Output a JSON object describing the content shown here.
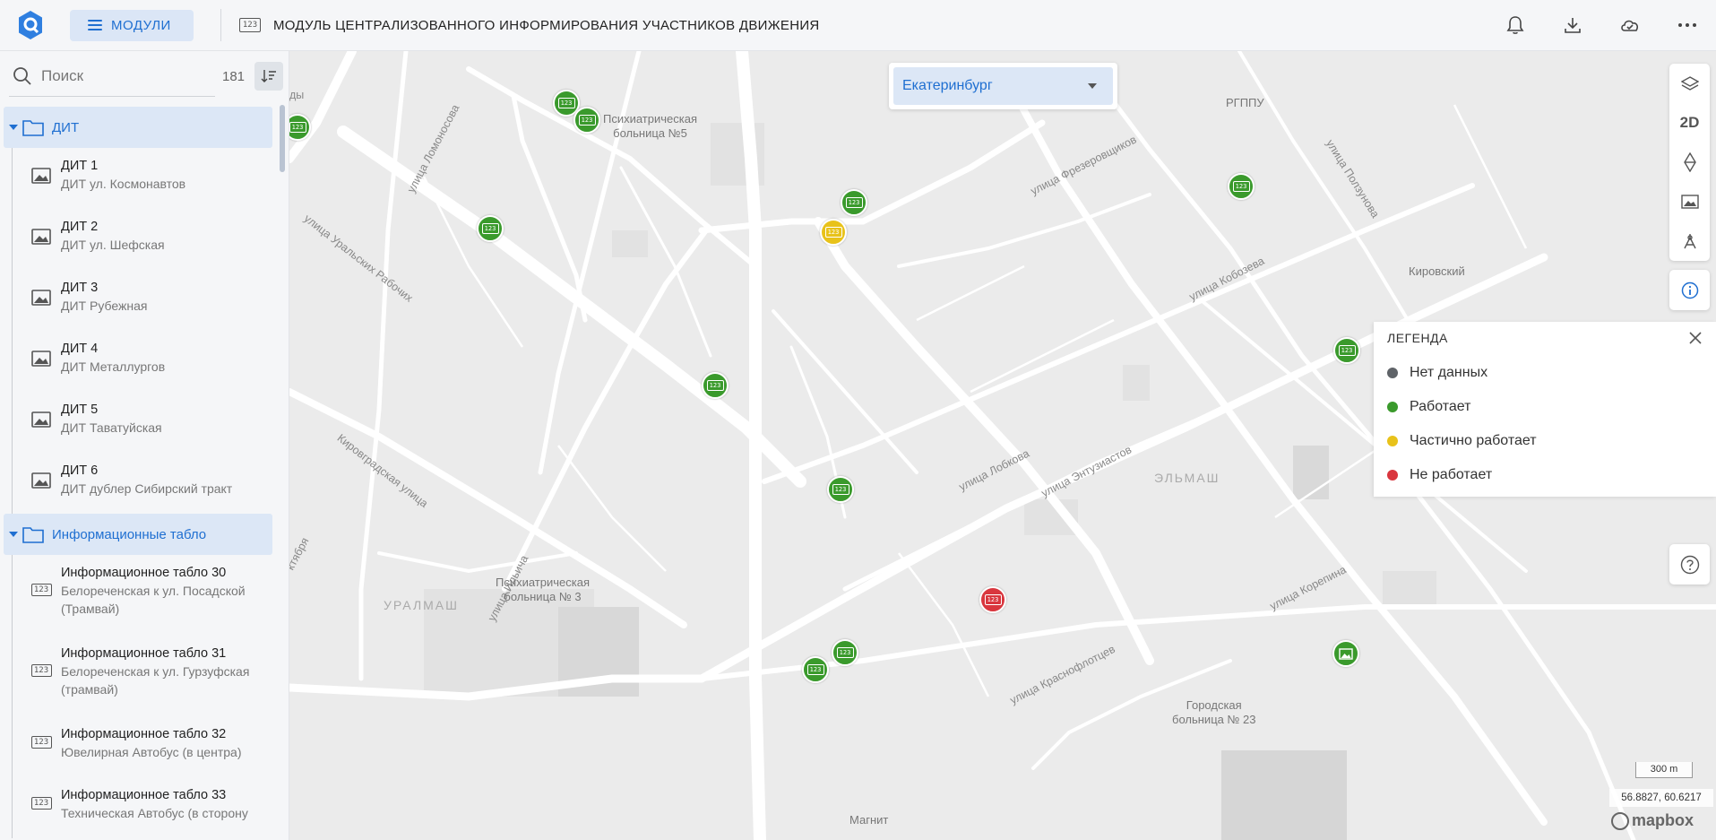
{
  "header": {
    "modules_label": "МОДУЛИ",
    "title": "МОДУЛЬ ЦЕНТРАЛИЗОВАННОГО ИНФОРМИРОВАНИЯ УЧАСТНИКОВ ДВИЖЕНИЯ",
    "title_icon_text": "123",
    "icons": [
      "bell-icon",
      "download-icon",
      "cloud-icon",
      "more-icon"
    ]
  },
  "sidebar": {
    "search_placeholder": "Поиск",
    "count": "181",
    "groups": [
      {
        "label": "ДИТ",
        "items": [
          {
            "name": "ДИТ 1",
            "sub": "ДИТ ул. Космонавтов"
          },
          {
            "name": "ДИТ 2",
            "sub": "ДИТ ул. Шефская"
          },
          {
            "name": "ДИТ 3",
            "sub": "ДИТ Рубежная"
          },
          {
            "name": "ДИТ 4",
            "sub": "ДИТ Металлургов"
          },
          {
            "name": "ДИТ 5",
            "sub": "ДИТ Таватуйская"
          },
          {
            "name": "ДИТ 6",
            "sub": "ДИТ дублер Сибирский тракт"
          }
        ]
      },
      {
        "label": "Информационные табло",
        "items": [
          {
            "name": "Информационное табло 30",
            "sub1": "Белореченская к ул. Посадской",
            "sub2": "(Трамвай)"
          },
          {
            "name": "Информационное табло 31",
            "sub1": "Белореченская к ул. Гурзуфская",
            "sub2": "(трамвай)"
          },
          {
            "name": "Информационное табло 32",
            "sub": "Ювелирная Автобус (в центра)"
          },
          {
            "name": "Информационное табло 33",
            "sub": "Техническая Автобус (в сторону"
          }
        ]
      }
    ]
  },
  "map": {
    "city": "Екатеринбург",
    "tools": [
      "layers-icon",
      "2D",
      "compass-icon",
      "image-icon",
      "ruler-icon"
    ],
    "streets": [
      "улица Ломоносова",
      "улица Уральских Рабочих",
      "Кировградская улица",
      "улица Ильича",
      "улица Фрезеровщиков",
      "улица Кобозева",
      "улица Лобкова",
      "улица Энтузиастов",
      "улица Краснофлотцев",
      "улица Корепина",
      "улица Ползунова",
      "ктября",
      "ды"
    ],
    "districts": [
      "УРАЛМАШ",
      "ЭЛЬМАШ"
    ],
    "pois": {
      "psych5_l1": "Психиатрическая",
      "psych5_l2": "больница №5",
      "psych3_l1": "Психиатрическая",
      "psych3_l2": "больница № 3",
      "hosp23_l1": "Городская",
      "hosp23_l2": "больница № 23",
      "rgppu": "РГППУ",
      "kirovsky": "Кировский",
      "magnit": "Магнит"
    },
    "markers": [
      {
        "status": "Работает",
        "color": "#3a9a2c",
        "icon": "display-123-icon"
      },
      {
        "status": "Частично работает",
        "color": "#e8c21a",
        "icon": "display-123-icon"
      },
      {
        "status": "Не работает",
        "color": "#d9363e",
        "icon": "display-123-icon"
      }
    ],
    "legend": {
      "title": "ЛЕГЕНДА",
      "items": [
        {
          "label": "Нет данных",
          "color": "#5f6368"
        },
        {
          "label": "Работает",
          "color": "#3a9a2c"
        },
        {
          "label": "Частично работает",
          "color": "#e8c21a"
        },
        {
          "label": "Не работает",
          "color": "#d9363e"
        }
      ]
    },
    "scale": "300 m",
    "coords": "56.8827, 60.6217",
    "attribution": "mapbox"
  },
  "colors": {
    "accent": "#1f6fd1",
    "selected_bg": "#dce7f6"
  }
}
